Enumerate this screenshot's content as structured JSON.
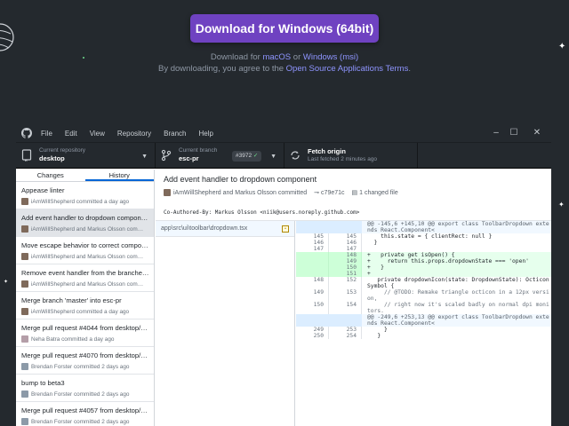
{
  "hero": {
    "download_button": "Download for Windows (64bit)",
    "alt_prefix": "Download for ",
    "alt_macos": "macOS",
    "alt_or": " or ",
    "alt_msi": "Windows (msi)",
    "terms_prefix": "By downloading, you agree to the ",
    "terms_link": "Open Source Applications Terms",
    "terms_suffix": "."
  },
  "menu": [
    "File",
    "Edit",
    "View",
    "Repository",
    "Branch",
    "Help"
  ],
  "toolbar": {
    "repo_label": "Current repository",
    "repo_value": "desktop",
    "branch_label": "Current branch",
    "branch_value": "esc-pr",
    "pr_badge": "#3972",
    "fetch_title": "Fetch origin",
    "fetch_sub": "Last fetched 2 minutes ago"
  },
  "sidebar": {
    "tabs": [
      "Changes",
      "History"
    ],
    "active_tab": "History",
    "items": [
      {
        "title": "Appease linter",
        "meta": "iAmWillShepherd committed a day ago",
        "selected": false
      },
      {
        "title": "Add event handler to dropdown compon…",
        "meta": "iAmWillShepherd and Markus Olsson com…",
        "selected": true
      },
      {
        "title": "Move escape behavior to correct compo…",
        "meta": "iAmWillShepherd and Markus Olsson com…",
        "selected": false
      },
      {
        "title": "Remove event handler from the branches…",
        "meta": "iAmWillShepherd and Markus Olsson com…",
        "selected": false
      },
      {
        "title": "Merge branch 'master' into esc-pr",
        "meta": "iAmWillShepherd committed a day ago",
        "selected": false
      },
      {
        "title": "Merge pull request #4044 from desktop/…",
        "meta": "Neha Batra committed a day ago",
        "selected": false
      },
      {
        "title": "Merge pull request #4070 from desktop/…",
        "meta": "Brendan Forster committed 2 days ago",
        "selected": false
      },
      {
        "title": "bump to beta3",
        "meta": "Brendan Forster committed 2 days ago",
        "selected": false
      },
      {
        "title": "Merge pull request #4057 from desktop/…",
        "meta": "Brendan Forster committed 2 days ago",
        "selected": false
      }
    ]
  },
  "commit": {
    "title": "Add event handler to dropdown component",
    "authors": "iAmWillShepherd and Markus Olsson committed",
    "sha": "c79e71c",
    "files_changed": "1 changed file",
    "body": "Co-Authored-By: Markus Olsson <niik@users.noreply.github.com>"
  },
  "files": [
    {
      "path": "app\\src\\ui\\toolbar\\dropdown.tsx",
      "status": "modified"
    }
  ],
  "diff": [
    {
      "type": "hunk",
      "old": "",
      "new": "",
      "text": "@@ -145,6 +145,10 @@ export class ToolbarDropdown extends React.Component<"
    },
    {
      "type": "ctx",
      "old": "145",
      "new": "145",
      "text": "    this.state = { clientRect: null }"
    },
    {
      "type": "ctx",
      "old": "146",
      "new": "146",
      "text": "  }"
    },
    {
      "type": "ctx",
      "old": "147",
      "new": "147",
      "text": ""
    },
    {
      "type": "add",
      "old": "",
      "new": "148",
      "text": "+   private get isOpen() {"
    },
    {
      "type": "add",
      "old": "",
      "new": "149",
      "text": "+     return this.props.dropdownState === 'open'"
    },
    {
      "type": "add",
      "old": "",
      "new": "150",
      "text": "+   }"
    },
    {
      "type": "add",
      "old": "",
      "new": "151",
      "text": "+"
    },
    {
      "type": "ctx",
      "old": "148",
      "new": "152",
      "text": "   private dropdownIcon(state: DropdownState): OcticonSymbol {"
    },
    {
      "type": "ctx",
      "old": "149",
      "new": "153",
      "text": "     // @TODO: Remake triangle octicon in a 12px version,"
    },
    {
      "type": "ctx",
      "old": "150",
      "new": "154",
      "text": "     // right now it's scaled badly on normal dpi monitors."
    },
    {
      "type": "hunk",
      "old": "",
      "new": "",
      "text": "@@ -249,6 +253,13 @@ export class ToolbarDropdown extends React.Component<"
    },
    {
      "type": "ctx",
      "old": "249",
      "new": "253",
      "text": "     }"
    },
    {
      "type": "ctx",
      "old": "250",
      "new": "254",
      "text": "   }"
    }
  ]
}
